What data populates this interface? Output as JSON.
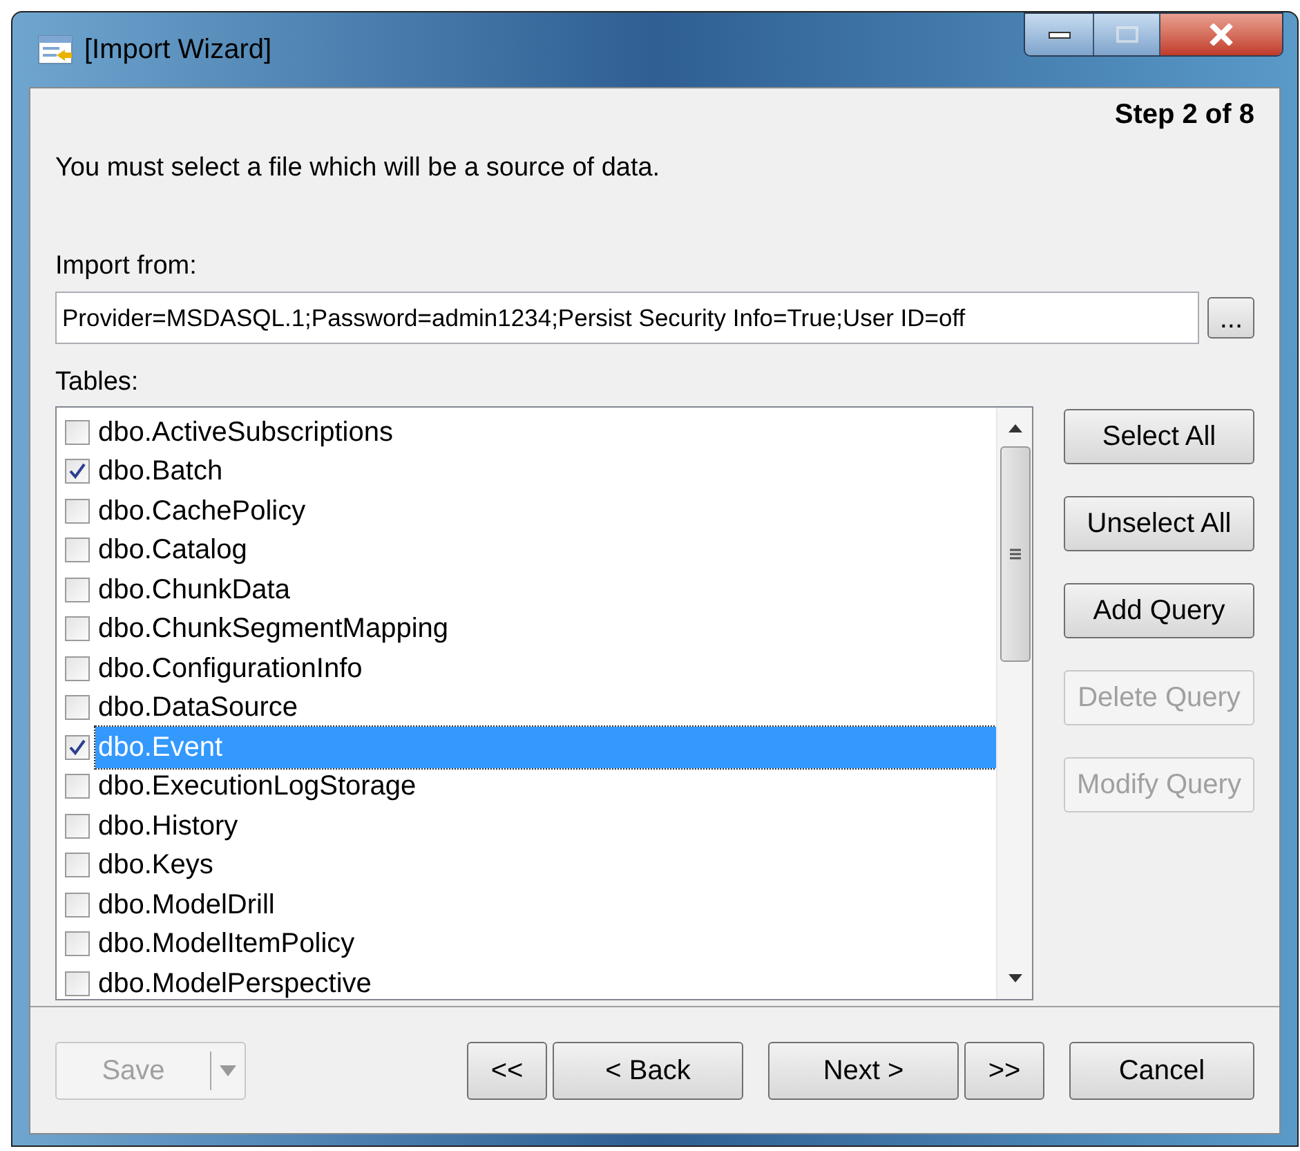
{
  "window": {
    "title": "[Import Wizard]"
  },
  "step": "Step 2 of 8",
  "instruction": "You must select a file which will be a source of data.",
  "import_from": {
    "label": "Import from:",
    "value": "Provider=MSDASQL.1;Password=admin1234;Persist Security Info=True;User ID=off",
    "browse_button": "..."
  },
  "tables": {
    "label": "Tables:",
    "items": [
      {
        "name": "dbo.ActiveSubscriptions",
        "checked": false,
        "selected": false
      },
      {
        "name": "dbo.Batch",
        "checked": true,
        "selected": false
      },
      {
        "name": "dbo.CachePolicy",
        "checked": false,
        "selected": false
      },
      {
        "name": "dbo.Catalog",
        "checked": false,
        "selected": false
      },
      {
        "name": "dbo.ChunkData",
        "checked": false,
        "selected": false
      },
      {
        "name": "dbo.ChunkSegmentMapping",
        "checked": false,
        "selected": false
      },
      {
        "name": "dbo.ConfigurationInfo",
        "checked": false,
        "selected": false
      },
      {
        "name": "dbo.DataSource",
        "checked": false,
        "selected": false
      },
      {
        "name": "dbo.Event",
        "checked": true,
        "selected": true
      },
      {
        "name": "dbo.ExecutionLogStorage",
        "checked": false,
        "selected": false
      },
      {
        "name": "dbo.History",
        "checked": false,
        "selected": false
      },
      {
        "name": "dbo.Keys",
        "checked": false,
        "selected": false
      },
      {
        "name": "dbo.ModelDrill",
        "checked": false,
        "selected": false
      },
      {
        "name": "dbo.ModelItemPolicy",
        "checked": false,
        "selected": false
      },
      {
        "name": "dbo.ModelPerspective",
        "checked": false,
        "selected": false
      }
    ]
  },
  "side_buttons": [
    {
      "label": "Select All",
      "disabled": false
    },
    {
      "label": "Unselect All",
      "disabled": false
    },
    {
      "label": "Add Query",
      "disabled": false
    },
    {
      "label": "Delete Query",
      "disabled": true
    },
    {
      "label": "Modify Query",
      "disabled": true
    }
  ],
  "footer": {
    "save": {
      "label": "Save",
      "disabled": true
    },
    "nav_buttons": [
      {
        "label": "<<",
        "kind": "small"
      },
      {
        "label": "< Back",
        "kind": "wide"
      },
      {
        "label": "Next >",
        "kind": "wide"
      },
      {
        "label": ">>",
        "kind": "small"
      }
    ],
    "cancel": "Cancel"
  }
}
